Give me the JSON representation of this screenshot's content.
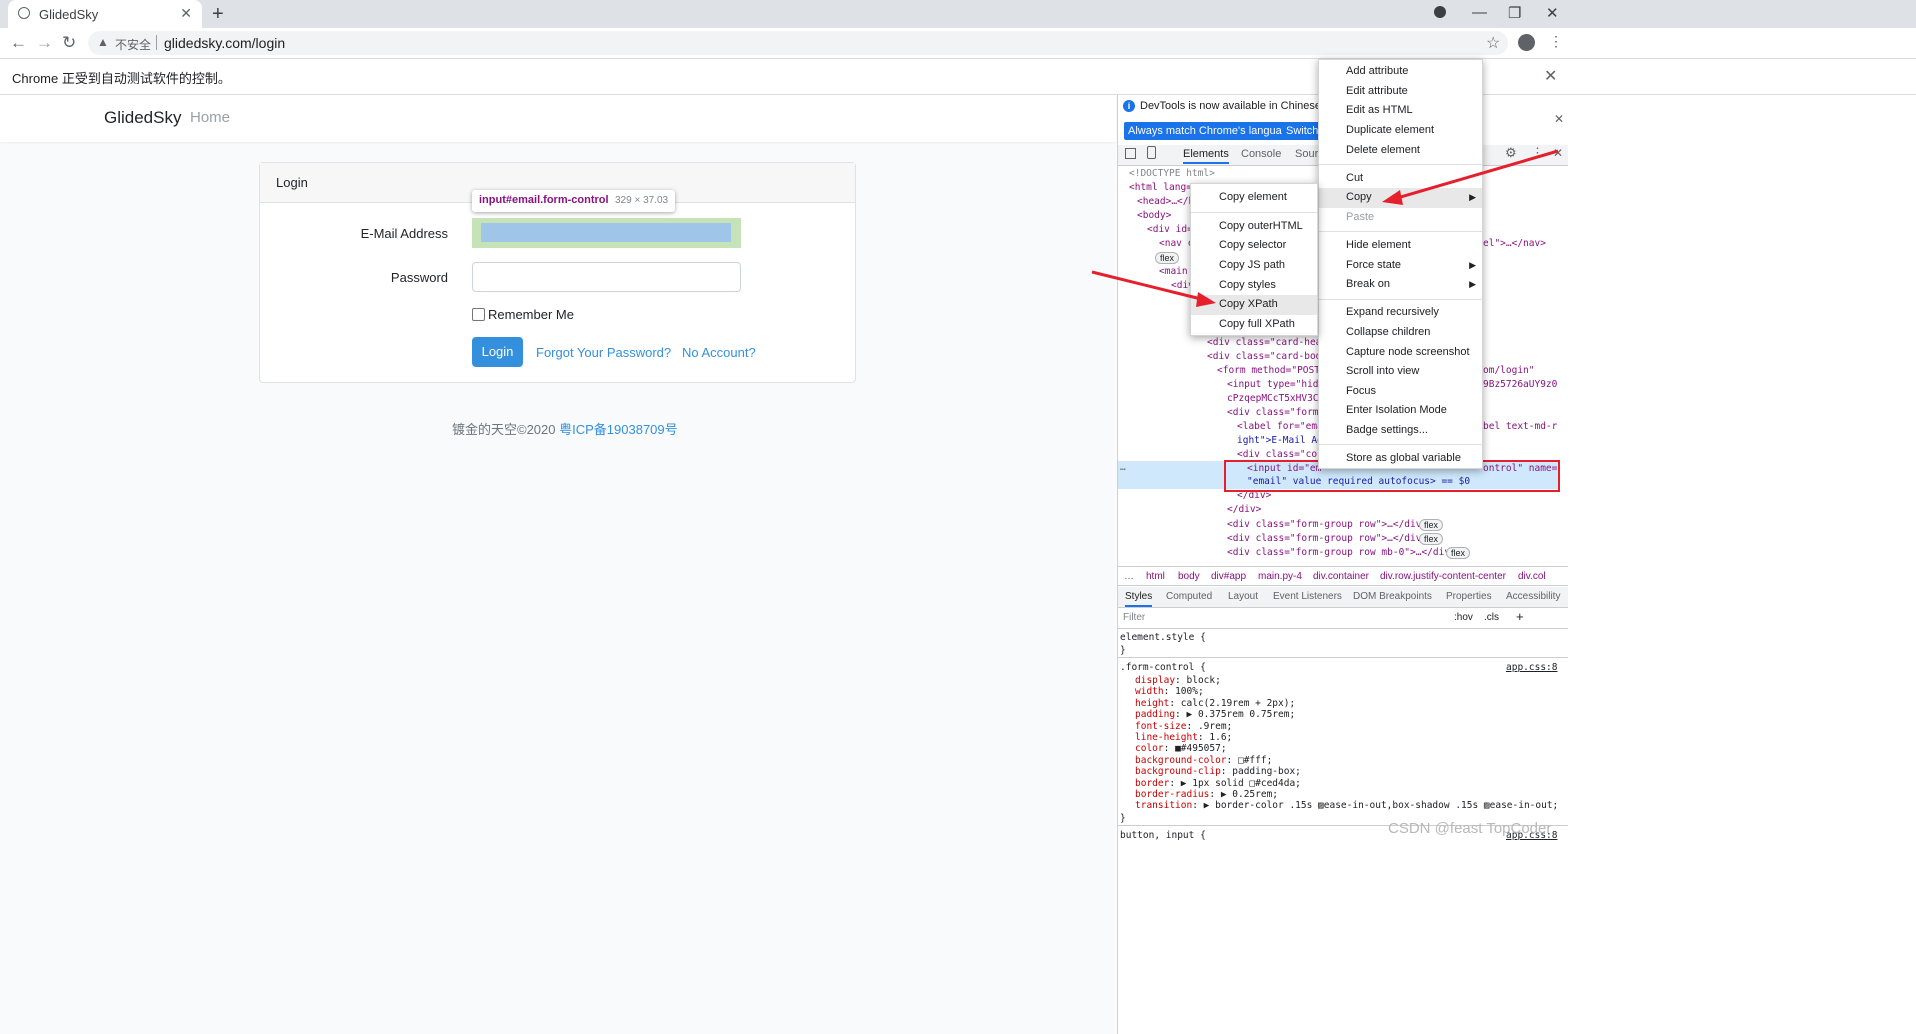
{
  "browser": {
    "tab_title": "GlidedSky",
    "new_tab": "+",
    "tab_close": "✕",
    "insecure_label": "不安全",
    "url": "glidedsky.com/login",
    "infobar_text": "Chrome 正受到自动测试软件的控制。",
    "infobar_close": "✕"
  },
  "site": {
    "brand": "GlidedSky",
    "nav_home": "Home",
    "card_title": "Login",
    "email_label": "E-Mail Address",
    "password_label": "Password",
    "remember_label": "Remember Me",
    "login_button": "Login",
    "forgot_link": "Forgot Your Password?",
    "no_account_link": "No Account?",
    "footer_text": "镀金的天空©2020",
    "footer_icp": "粤ICP备19038709号",
    "inspect_selector": "input#email.form-control",
    "inspect_size": "329 × 37.03"
  },
  "devtools": {
    "lang_notice": "DevTools is now available in Chinese!",
    "lang_btn_match": "Always match Chrome's language",
    "lang_btn_switch": "Switch",
    "tab_elements": "Elements",
    "tab_console": "Console",
    "tab_sources": "Sour",
    "dom_lines": [
      "<!DOCTYPE html>",
      "<html lang=",
      "<head>…</h",
      "<body>",
      "<div id=",
      "<nav c",
      "<main",
      "<div",
      "<div class=\"card-hea",
      "<div class=\"card-body",
      "<form method=\"POST\"",
      "<input type=\"hid",
      "cPzqepMCcT5xHV3C",
      "<div class=\"form-",
      "<label for=\"ema",
      "ight\">E-Mail Ad",
      "<div class=\"col",
      "<input id=\"em",
      "\"email\" value required autofocus> == $0",
      "</div>",
      "</div>",
      "<div class=\"form-group row\">…</div>",
      "<div class=\"form-group row\">…</div>",
      "<div class=\"form-group row mb-0\">…</div>"
    ],
    "dom_right_fragments": [
      "el\">…</nav>",
      "om/login\"",
      "9Bz5726aUY9z0",
      "bel text-md-r",
      "ontrol\" name="
    ],
    "flex_badge": "flex",
    "breadcrumbs": [
      "…",
      "html",
      "body",
      "div#app",
      "main.py-4",
      "div.container",
      "div.row.justify-content-center",
      "div.col"
    ],
    "subtabs": [
      "Styles",
      "Computed",
      "Layout",
      "Event Listeners",
      "DOM Breakpoints",
      "Properties",
      "Accessibility"
    ],
    "filter_placeholder": "Filter",
    "filter_hov": ":hov",
    "filter_cls": ".cls",
    "styles": {
      "element_style": "element.style {",
      "close_brace": "}",
      "rule_selector": ".form-control {",
      "rule_source": "app.css:8",
      "props": [
        {
          "name": "display",
          "value": "block;"
        },
        {
          "name": "width",
          "value": "100%;"
        },
        {
          "name": "height",
          "value": "calc(2.19rem + 2px);"
        },
        {
          "name": "padding",
          "value": "▶ 0.375rem 0.75rem;"
        },
        {
          "name": "font-size",
          "value": ".9rem;"
        },
        {
          "name": "line-height",
          "value": "1.6;"
        },
        {
          "name": "color",
          "value": "■#495057;"
        },
        {
          "name": "background-color",
          "value": "□#fff;"
        },
        {
          "name": "background-clip",
          "value": "padding-box;"
        },
        {
          "name": "border",
          "value": "▶ 1px solid □#ced4da;"
        },
        {
          "name": "border-radius",
          "value": "▶ 0.25rem;"
        },
        {
          "name": "transition",
          "value": "▶ border-color .15s ▨ease-in-out,box-shadow .15s ▨ease-in-out;"
        }
      ],
      "next_rule": "button, input {",
      "next_source": "app.css:8"
    }
  },
  "context_menu_main": {
    "items": [
      {
        "label": "Add attribute"
      },
      {
        "label": "Edit attribute"
      },
      {
        "label": "Edit as HTML"
      },
      {
        "label": "Duplicate element"
      },
      {
        "label": "Delete element"
      },
      {
        "label": "Cut"
      },
      {
        "label": "Copy",
        "submenu": true,
        "highlighted": true
      },
      {
        "label": "Paste",
        "disabled": true
      },
      {
        "label": "Hide element"
      },
      {
        "label": "Force state",
        "submenu": true
      },
      {
        "label": "Break on",
        "submenu": true
      },
      {
        "label": "Expand recursively"
      },
      {
        "label": "Collapse children"
      },
      {
        "label": "Capture node screenshot"
      },
      {
        "label": "Scroll into view"
      },
      {
        "label": "Focus"
      },
      {
        "label": "Enter Isolation Mode"
      },
      {
        "label": "Badge settings..."
      },
      {
        "label": "Store as global variable"
      }
    ]
  },
  "context_menu_copy": {
    "items": [
      {
        "label": "Copy element"
      },
      {
        "label": "Copy outerHTML"
      },
      {
        "label": "Copy selector"
      },
      {
        "label": "Copy JS path"
      },
      {
        "label": "Copy styles"
      },
      {
        "label": "Copy XPath",
        "highlighted": true
      },
      {
        "label": "Copy full XPath"
      }
    ]
  },
  "watermark": "CSDN @feast TopCoder",
  "colors": {
    "accent_blue": "#3490dc",
    "devtools_blue": "#1a73e8",
    "annotation_red": "#e5202c",
    "email_highlight": "#c6e2b7",
    "email_content": "#9fc5e8"
  }
}
